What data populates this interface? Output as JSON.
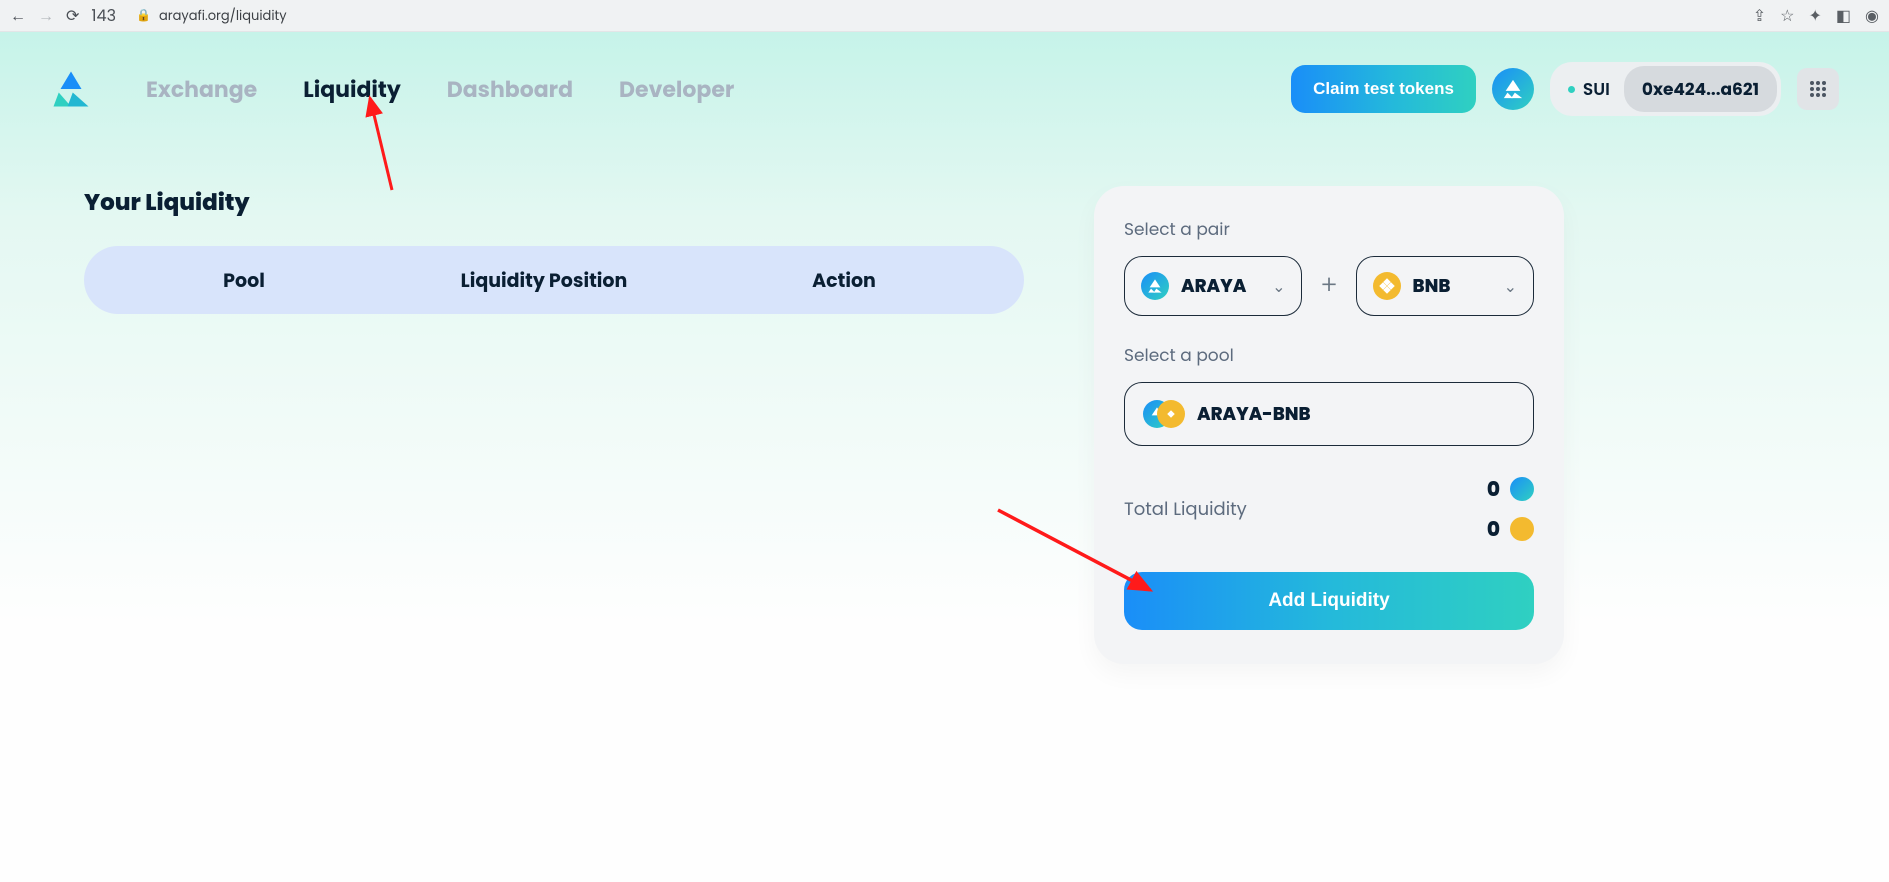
{
  "browser": {
    "tab_count": "143",
    "url": "arayafi.org/liquidity"
  },
  "nav": {
    "items": [
      "Exchange",
      "Liquidity",
      "Dashboard",
      "Developer"
    ],
    "active_index": 1
  },
  "header": {
    "claim_label": "Claim test tokens",
    "network": "SUI",
    "wallet": "0xe424...a621"
  },
  "liquidity": {
    "title": "Your Liquidity",
    "columns": {
      "pool": "Pool",
      "position": "Liquidity Position",
      "action": "Action"
    }
  },
  "panel": {
    "select_pair_label": "Select a pair",
    "token_a": "ARAYA",
    "token_b": "BNB",
    "select_pool_label": "Select a pool",
    "pool_name": "ARAYA-BNB",
    "total_liquidity_label": "Total Liquidity",
    "total_a": "0",
    "total_b": "0",
    "add_label": "Add Liquidity"
  }
}
